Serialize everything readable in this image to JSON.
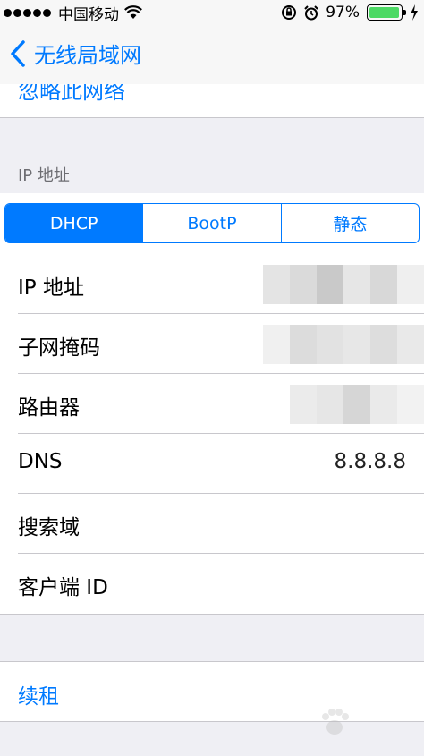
{
  "status_bar": {
    "carrier": "中国移动",
    "battery_percent": "97%",
    "battery_level": 0.97,
    "icons": [
      "signal-dots-icon",
      "wifi-icon",
      "rotation-lock-icon",
      "alarm-icon",
      "battery-icon",
      "charging-icon"
    ]
  },
  "nav": {
    "back_label": "无线局域网"
  },
  "top_cell": {
    "label": "忽略此网络"
  },
  "ip_section": {
    "header": "IP 地址",
    "segments": [
      {
        "label": "DHCP",
        "selected": true
      },
      {
        "label": "BootP",
        "selected": false
      },
      {
        "label": "静态",
        "selected": false
      }
    ],
    "rows": [
      {
        "label": "IP 地址",
        "value": ""
      },
      {
        "label": "子网掩码",
        "value": ""
      },
      {
        "label": "路由器",
        "value": ""
      },
      {
        "label": "DNS",
        "value": "8.8.8.8"
      },
      {
        "label": "搜索域",
        "value": ""
      },
      {
        "label": "客户端 ID",
        "value": ""
      }
    ]
  },
  "renew": {
    "label": "续租"
  },
  "colors": {
    "accent": "#007aff",
    "background": "#efeff4",
    "battery": "#4cd964"
  }
}
